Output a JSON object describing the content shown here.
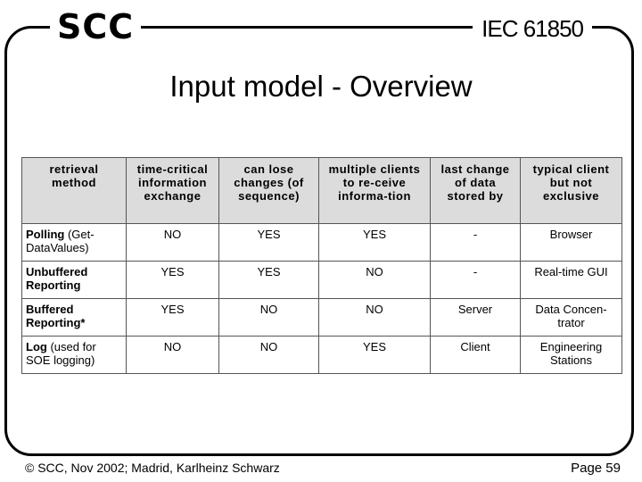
{
  "header": {
    "logo": "SCC",
    "standard": "IEC 61850"
  },
  "title": "Input model - Overview",
  "table": {
    "columns": [
      "retrieval method",
      "time-critical information exchange",
      "can lose changes (of sequence)",
      "multiple clients to re-ceive informa-tion",
      "last change of data stored by",
      "typical client but not exclusive"
    ],
    "rows": [
      {
        "method_bold": "Polling",
        "method_rest": " (Get-DataValues)",
        "cells": [
          "NO",
          "YES",
          "YES",
          "-",
          "Browser"
        ]
      },
      {
        "method_bold": "Unbuffered Reporting",
        "method_rest": "",
        "cells": [
          "YES",
          "YES",
          "NO",
          "-",
          "Real-time GUI"
        ]
      },
      {
        "method_bold": "Buffered Reporting*",
        "method_rest": "",
        "cells": [
          "YES",
          "NO",
          "NO",
          "Server",
          "Data Concen-trator"
        ]
      },
      {
        "method_bold": "Log",
        "method_rest": " (used for SOE logging)",
        "cells": [
          "NO",
          "NO",
          "YES",
          "Client",
          "Engineering Stations"
        ]
      }
    ]
  },
  "footer": {
    "copyright": "© SCC, Nov 2002; Madrid, Karlheinz Schwarz",
    "page": "Page 59"
  }
}
